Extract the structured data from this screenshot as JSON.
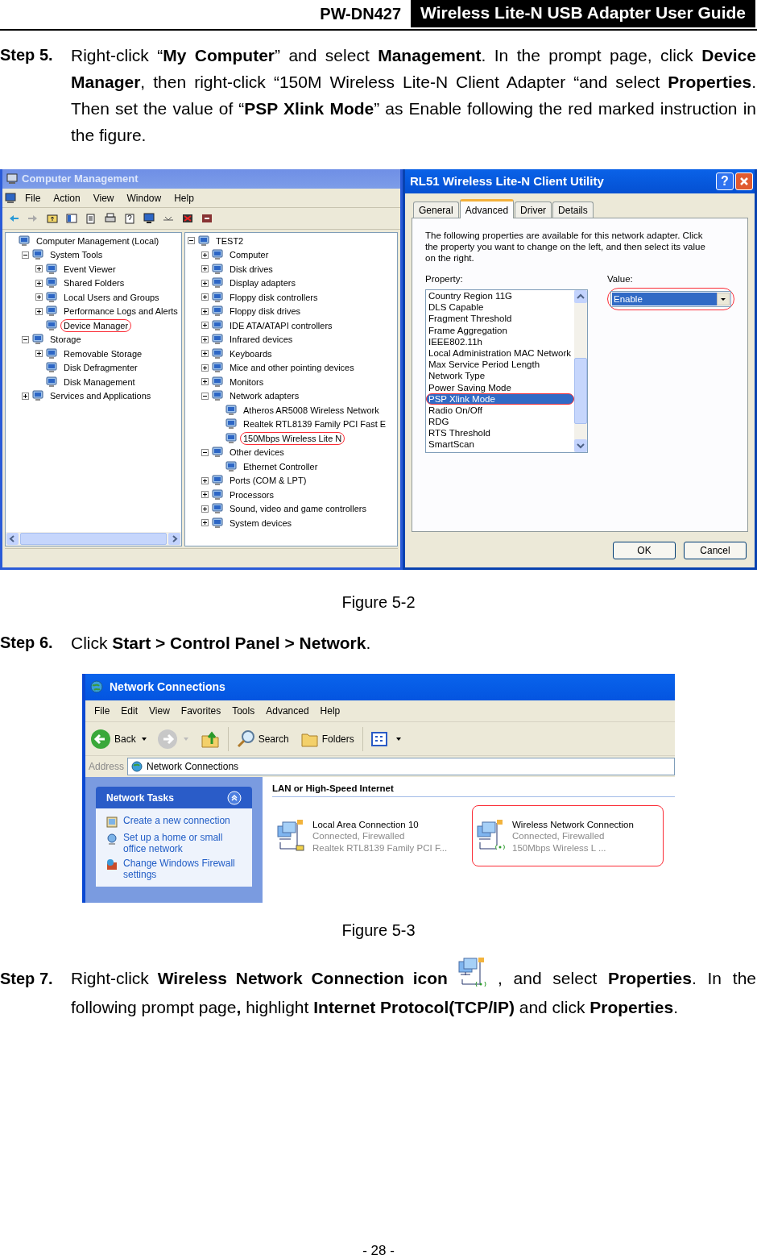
{
  "header": {
    "product": "PW-DN427",
    "title": "Wireless Lite-N USB Adapter User Guide"
  },
  "step_5": {
    "label": "Step 5.",
    "text": "Right-click “**My Computer**” and select **Management**. In the prompt page, click **Device Manager**, then right-click “150M Wireless Lite-N Client Adapter “and select **Properties**. Then set the value of “**PSP Xlink Mode**” as Enable following the red marked instruction in the figure."
  },
  "figure_5_2": {
    "computer_management": {
      "title": "Computer Management",
      "menu": [
        "File",
        "Action",
        "View",
        "Window",
        "Help"
      ],
      "left_tree": [
        {
          "label": "Computer Management (Local)",
          "marked": false,
          "children": [
            {
              "label": "System Tools",
              "expanded": true,
              "marked": false,
              "children": [
                {
                  "label": "Event Viewer",
                  "expanded": false,
                  "marked": false
                },
                {
                  "label": "Shared Folders",
                  "expanded": false,
                  "marked": false
                },
                {
                  "label": "Local Users and Groups",
                  "expanded": false,
                  "marked": false
                },
                {
                  "label": "Performance Logs and Alerts",
                  "expanded": false,
                  "marked": false
                },
                {
                  "label": "Device Manager",
                  "marked": true
                }
              ]
            },
            {
              "label": "Storage",
              "expanded": true,
              "marked": false,
              "children": [
                {
                  "label": "Removable Storage",
                  "expanded": false,
                  "marked": false
                },
                {
                  "label": "Disk Defragmenter",
                  "marked": false
                },
                {
                  "label": "Disk Management",
                  "marked": false
                }
              ]
            },
            {
              "label": "Services and Applications",
              "expanded": false,
              "marked": false
            }
          ]
        }
      ],
      "right_tree": [
        {
          "label": "TEST2",
          "expanded": true,
          "marked": false,
          "children": [
            {
              "label": "Computer",
              "expanded": false,
              "marked": false
            },
            {
              "label": "Disk drives",
              "expanded": false,
              "marked": false
            },
            {
              "label": "Display adapters",
              "expanded": false,
              "marked": false
            },
            {
              "label": "Floppy disk controllers",
              "expanded": false,
              "marked": false
            },
            {
              "label": "Floppy disk drives",
              "expanded": false,
              "marked": false
            },
            {
              "label": "IDE ATA/ATAPI controllers",
              "expanded": false,
              "marked": false
            },
            {
              "label": "Infrared devices",
              "expanded": false,
              "marked": false
            },
            {
              "label": "Keyboards",
              "expanded": false,
              "marked": false
            },
            {
              "label": "Mice and other pointing devices",
              "expanded": false,
              "marked": false
            },
            {
              "label": "Monitors",
              "expanded": false,
              "marked": false
            },
            {
              "label": "Network adapters",
              "expanded": true,
              "marked": false,
              "children": [
                {
                  "label": "Atheros AR5008 Wireless Network",
                  "marked": false
                },
                {
                  "label": "Realtek RTL8139 Family PCI Fast E",
                  "marked": false
                },
                {
                  "label": "150Mbps Wireless Lite N",
                  "marked": true
                }
              ]
            },
            {
              "label": "Other devices",
              "expanded": true,
              "marked": false,
              "children": [
                {
                  "label": "Ethernet Controller",
                  "marked": false
                }
              ]
            },
            {
              "label": "Ports (COM & LPT)",
              "expanded": false,
              "marked": false
            },
            {
              "label": "Processors",
              "expanded": false,
              "marked": false
            },
            {
              "label": "Sound, video and game controllers",
              "expanded": false,
              "marked": false
            },
            {
              "label": "System devices",
              "expanded": false,
              "marked": false
            }
          ]
        }
      ]
    },
    "adapter_properties": {
      "title": "RL51 Wireless Lite-N Client Utility",
      "help_button": "?",
      "tabs": [
        {
          "label": "General",
          "selected": false
        },
        {
          "label": "Advanced",
          "selected": true
        },
        {
          "label": "Driver",
          "selected": false
        },
        {
          "label": "Details",
          "selected": false
        }
      ],
      "description": "The following properties are available for this network adapter. Click the property you want to change on the left, and then select its value on the right.",
      "property_label": "Property:",
      "properties": [
        {
          "label": "Country Region 11G",
          "selected": false,
          "marked": false
        },
        {
          "label": "DLS Capable",
          "selected": false,
          "marked": false
        },
        {
          "label": "Fragment Threshold",
          "selected": false,
          "marked": false
        },
        {
          "label": "Frame Aggregation",
          "selected": false,
          "marked": false
        },
        {
          "label": "IEEE802.11h",
          "selected": false,
          "marked": false
        },
        {
          "label": "Local Administration MAC Network",
          "selected": false,
          "marked": false
        },
        {
          "label": "Max Service Period Length",
          "selected": false,
          "marked": false
        },
        {
          "label": "Network Type",
          "selected": false,
          "marked": false
        },
        {
          "label": "Power Saving Mode",
          "selected": false,
          "marked": false
        },
        {
          "label": "PSP Xlink Mode",
          "selected": true,
          "marked": true
        },
        {
          "label": "Radio On/Off",
          "selected": false,
          "marked": false
        },
        {
          "label": "RDG",
          "selected": false,
          "marked": false
        },
        {
          "label": "RTS Threshold",
          "selected": false,
          "marked": false
        },
        {
          "label": "SmartScan",
          "selected": false,
          "marked": false
        }
      ],
      "value_label": "Value:",
      "value": {
        "text": "Enable",
        "marked": true
      },
      "buttons": [
        "OK",
        "Cancel"
      ]
    },
    "caption": "Figure 5-2"
  },
  "step_6": {
    "label": "Step 6.",
    "text": "Click **Start > Control Panel > Network**."
  },
  "figure_5_3": {
    "network_connections": {
      "title": "Network Connections",
      "menu": [
        "File",
        "Edit",
        "View",
        "Favorites",
        "Tools",
        "Advanced",
        "Help"
      ],
      "back_button": "Back",
      "search_button": "Search",
      "folders_button": "Folders",
      "address_label": "Address",
      "address": "Network Connections",
      "tasks": {
        "title": "Network Tasks",
        "links": [
          "Create a new connection",
          "Set up a home or small office network",
          "Change Windows Firewall settings"
        ]
      },
      "group": "LAN or High-Speed Internet",
      "connections": [
        {
          "kind": "wired",
          "name": "Local Area Connection 10",
          "status": "Connected, Firewalled",
          "device": "Realtek RTL8139 Family PCI F...",
          "marked": false
        },
        {
          "kind": "wireless",
          "name": "Wireless Network Connection",
          "status": "Connected, Firewalled",
          "device": "150Mbps Wireless L ...",
          "marked": true
        }
      ]
    },
    "caption": "Figure 5-3"
  },
  "step_7": {
    "label": "Step 7.",
    "text_before": "Right-click **Wireless Network Connection icon**",
    "text_after": ", and select **Properties**. In the",
    "text_next_line": "following prompt page**,** highlight **Internet Protocol(TCP/IP)** and click **Properties**."
  },
  "page_number": "- 28 -"
}
